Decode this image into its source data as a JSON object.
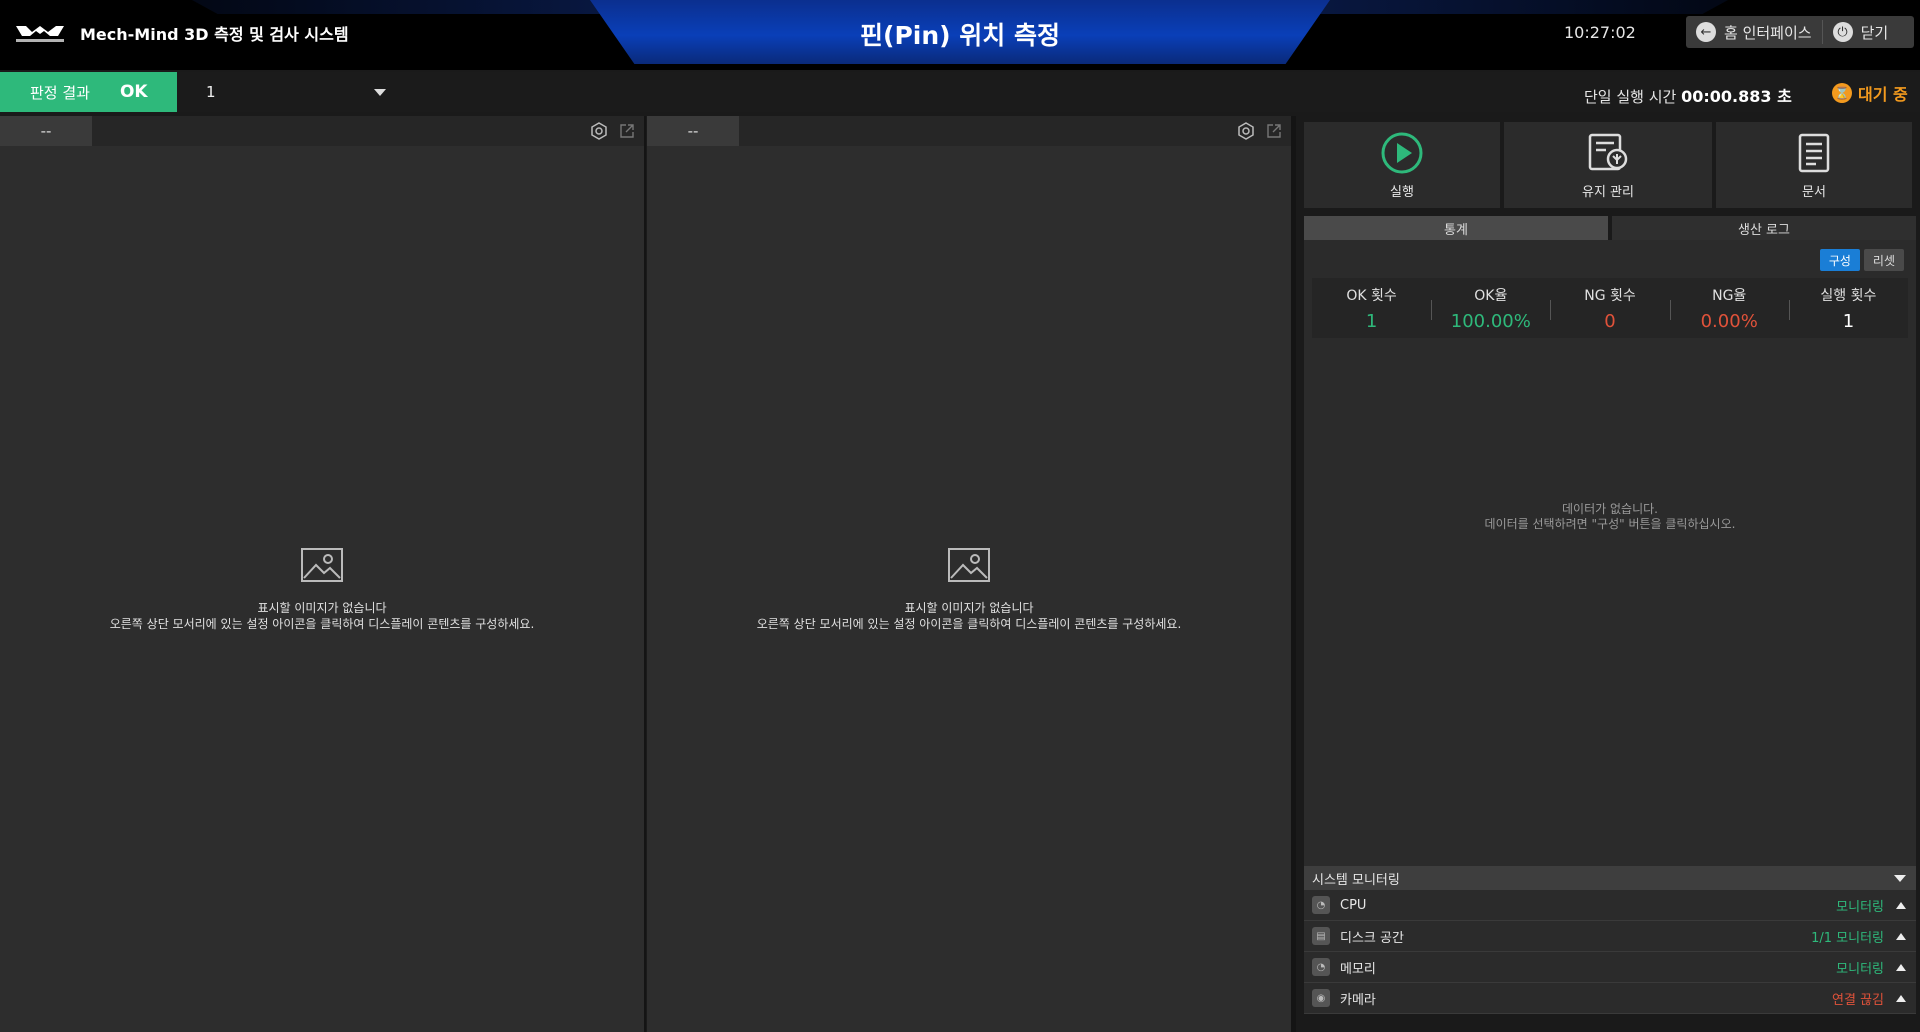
{
  "header": {
    "app_title": "Mech-Mind 3D 측정 및 검사 시스템",
    "page_title": "핀(Pin) 위치 측정",
    "clock": "10:27:02",
    "home_label": "홈 인터페이스",
    "close_label": "닫기",
    "logo_icon": "mech-mind-logo"
  },
  "status": {
    "verdict_label": "판정 결과",
    "verdict_value": "OK",
    "selector_value": "1",
    "runtime_label": "단일 실행 시간",
    "runtime_value": "00:00.883 초",
    "state_label": "대기 중",
    "colors": {
      "ok": "#2eb97b",
      "waiting": "#f39a1e"
    }
  },
  "viewers": [
    {
      "tab": "--",
      "empty_title": "표시할 이미지가 없습니다",
      "empty_hint": "오른쪽 상단 모서리에 있는 설정 아이콘을 클릭하여 디스플레이 콘텐츠를 구성하세요."
    },
    {
      "tab": "--",
      "empty_title": "표시할 이미지가 없습니다",
      "empty_hint": "오른쪽 상단 모서리에 있는 설정 아이콘을 클릭하여 디스플레이 콘텐츠를 구성하세요."
    }
  ],
  "tools": [
    {
      "label": "실행",
      "icon": "play-icon"
    },
    {
      "label": "유지 관리",
      "icon": "maintenance-icon"
    },
    {
      "label": "문서",
      "icon": "document-icon"
    }
  ],
  "tabs": {
    "stats": "통계",
    "log": "생산 로그"
  },
  "stats": {
    "config_label": "구성",
    "reset_label": "리셋",
    "items": [
      {
        "header": "OK 횟수",
        "value": "1",
        "color": "#2eb97b"
      },
      {
        "header": "OK율",
        "value": "100.00%",
        "color": "#2eb97b"
      },
      {
        "header": "NG 횟수",
        "value": "0",
        "color": "#e0523a"
      },
      {
        "header": "NG율",
        "value": "0.00%",
        "color": "#e0523a"
      },
      {
        "header": "실행 횟수",
        "value": "1",
        "color": "#ffffff"
      }
    ],
    "no_data": "데이터가 없습니다.",
    "no_data_hint": "데이터를 선택하려면 \"구성\" 버튼을 클릭하십시오."
  },
  "monitor": {
    "title": "시스템 모니터링",
    "rows": [
      {
        "name": "CPU",
        "status": "모니터링",
        "color": "#2eb97b",
        "icon": "gauge-icon"
      },
      {
        "name": "디스크 공간",
        "status": "1/1 모니터링",
        "color": "#2eb97b",
        "icon": "disk-icon"
      },
      {
        "name": "메모리",
        "status": "모니터링",
        "color": "#2eb97b",
        "icon": "memory-icon"
      },
      {
        "name": "카메라",
        "status": "연결 끊김",
        "color": "#e0523a",
        "icon": "camera-icon"
      }
    ]
  }
}
